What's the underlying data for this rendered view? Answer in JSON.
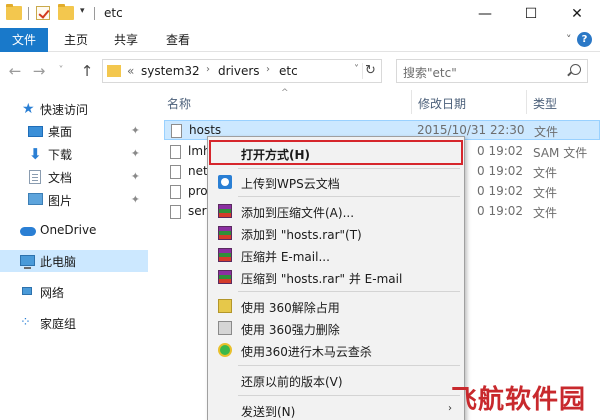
{
  "window": {
    "title": "etc",
    "minimize": "—",
    "maximize": "☐",
    "close": "✕"
  },
  "ribbon": {
    "tabs": [
      "文件",
      "主页",
      "共享",
      "查看"
    ],
    "expand": "˅",
    "help": "?"
  },
  "address": {
    "back": "←",
    "forward": "→",
    "recent": "˅",
    "up": "↑",
    "overflow": "«",
    "crumbs": [
      "system32",
      "drivers",
      "etc"
    ],
    "crumb_sep": "›",
    "dropdown": "˅",
    "refresh": "↻"
  },
  "search": {
    "placeholder": "搜索\"etc\""
  },
  "sidebar": {
    "items": [
      {
        "label": "快速访问",
        "icon": "star-icon"
      },
      {
        "label": "桌面",
        "icon": "desktop-icon",
        "pinned": true
      },
      {
        "label": "下载",
        "icon": "download-icon",
        "pinned": true
      },
      {
        "label": "文档",
        "icon": "document-icon",
        "pinned": true
      },
      {
        "label": "图片",
        "icon": "picture-icon",
        "pinned": true
      },
      {
        "label": "OneDrive",
        "icon": "onedrive-icon"
      },
      {
        "label": "此电脑",
        "icon": "this-pc-icon",
        "selected": true
      },
      {
        "label": "网络",
        "icon": "network-icon"
      },
      {
        "label": "家庭组",
        "icon": "homegroup-icon"
      }
    ],
    "pin_glyph": "📌"
  },
  "content": {
    "sort_glyph": "^",
    "columns": [
      "名称",
      "修改日期",
      "类型"
    ],
    "files": [
      {
        "name": "hosts",
        "date": "2015/10/31 22:30",
        "type": "文件",
        "selected": true
      },
      {
        "name": "lmh",
        "date": "0 19:02",
        "type": "SAM 文件"
      },
      {
        "name": "netw",
        "date": "0 19:02",
        "type": "文件"
      },
      {
        "name": "prot",
        "date": "0 19:02",
        "type": "文件"
      },
      {
        "name": "serv",
        "date": "0 19:02",
        "type": "文件"
      }
    ]
  },
  "context_menu": {
    "items": [
      {
        "label": "打开方式(H)",
        "bold": true,
        "highlighted": true
      },
      {
        "label": "上传到WPS云文档",
        "icon": "wps-cloud-icon"
      },
      {
        "label": "添加到压缩文件(A)...",
        "icon": "winrar-icon"
      },
      {
        "label": "添加到 \"hosts.rar\"(T)",
        "icon": "winrar-icon"
      },
      {
        "label": "压缩并 E-mail...",
        "icon": "winrar-icon"
      },
      {
        "label": "压缩到 \"hosts.rar\" 并 E-mail",
        "icon": "winrar-icon"
      },
      {
        "label": "使用 360解除占用",
        "icon": "unlock-360-icon"
      },
      {
        "label": "使用 360强力删除",
        "icon": "shred-360-icon"
      },
      {
        "label": "使用360进行木马云查杀",
        "icon": "scan-360-icon"
      },
      {
        "label": "还原以前的版本(V)"
      },
      {
        "label": "发送到(N)",
        "submenu": true
      }
    ],
    "submenu_arrow": "›"
  },
  "colors": {
    "accent": "#1979ca",
    "selection": "#cce8ff",
    "highlight_box": "#d6262c"
  },
  "watermark": "飞航软件园"
}
